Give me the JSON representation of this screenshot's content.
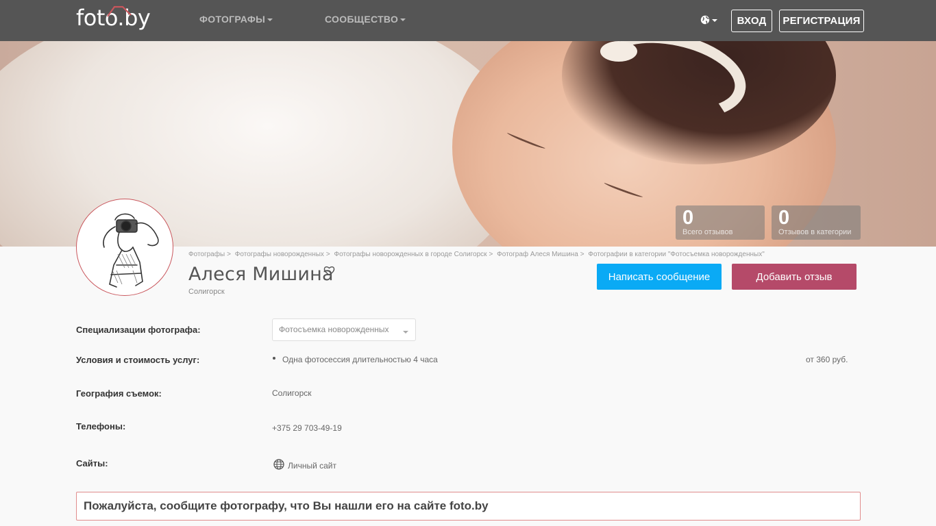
{
  "header": {
    "logo_text": "foto.by",
    "nav": [
      {
        "label": "ФОТОГРАФЫ"
      },
      {
        "label": "СООБЩЕСТВО"
      }
    ],
    "login_label": "ВХОД",
    "register_label": "РЕГИСТРАЦИЯ",
    "icons": {
      "language": "globe-icon",
      "caret": "caret-down-icon"
    }
  },
  "stats": [
    {
      "value": "0",
      "label": "Всего отзывов"
    },
    {
      "value": "0",
      "label": "Отзывов в категории"
    }
  ],
  "breadcrumb": [
    "Фотографы",
    "Фотографы новорожденных",
    "Фотографы новорожденных в городе Солигорск",
    "Фотограф Алеся Мишина",
    "Фотографии в категории \"Фотосъемка новорожденных\""
  ],
  "profile": {
    "name": "Алеся Мишина",
    "city": "Солигорск",
    "message_button": "Написать сообщение",
    "review_button": "Добавить отзыв"
  },
  "details": {
    "specialization_label": "Специализации фотографа:",
    "specialization_value": "Фотосъемка новорожденных",
    "services_label": "Условия и стоимость услуг:",
    "service_item": "Одна фотосессия длительностью 4 часа",
    "service_price": "от 360 руб.",
    "geography_label": "География съемок:",
    "geography_value": "Солигорск",
    "phones_label": "Телефоны:",
    "phone_value": "+375 29 703-49-19",
    "sites_label": "Сайты:",
    "site_value": "Личный сайт"
  },
  "notice": "Пожалуйста, сообщите фотографу, что Вы нашли его на сайте foto.by",
  "colors": {
    "topbar": "#555555",
    "message_button": "#0aaaf5",
    "review_button": "#b54a69",
    "notice_border": "#e08c8c"
  }
}
